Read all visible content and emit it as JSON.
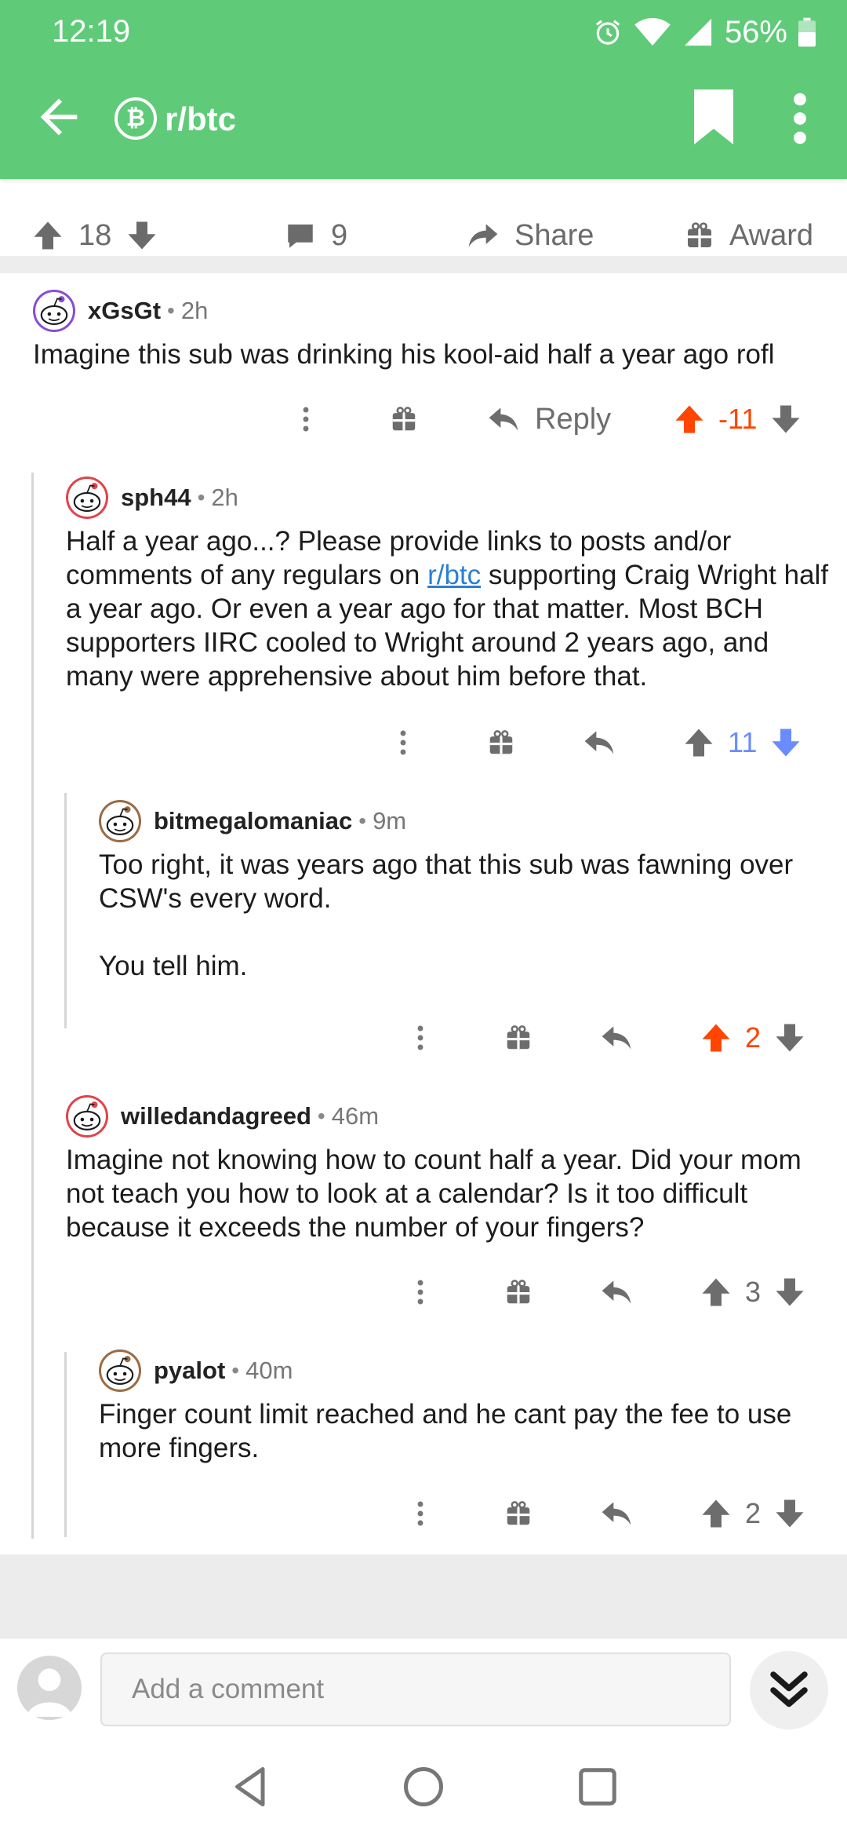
{
  "status": {
    "time": "12:19",
    "battery": "56%",
    "icons": [
      "alarm-icon",
      "wifi-icon",
      "signal-icon",
      "battery-icon"
    ]
  },
  "header": {
    "subreddit": "r/btc",
    "badge": "₿"
  },
  "post_bar": {
    "upvotes": "18",
    "comments": "9",
    "share": "Share",
    "award": "Award"
  },
  "colors": {
    "header": "#5fcb78",
    "upvoted": "#ff4500",
    "downvoted": "#6a8cff",
    "link": "#2a7fd4"
  },
  "comments": [
    {
      "author": "xGsGt",
      "age": "2h",
      "body": "Imagine this sub was drinking his kool-aid half a year ago rofl",
      "reply_label": "Reply",
      "score": "-11",
      "vote": "up"
    },
    {
      "author": "sph44",
      "age": "2h",
      "body_before": "Half a year ago...?  Please provide links to posts and/or comments of any regulars on ",
      "body_link": "r/btc",
      "body_after": " supporting Craig Wright half a year ago.  Or even a year ago for that matter.  Most BCH supporters IIRC cooled to Wright around 2 years ago, and many were apprehensive about him before that.",
      "score": "11",
      "vote": "down"
    },
    {
      "author": "bitmegalomaniac",
      "age": "9m",
      "body_p1": "Too right, it was years ago that this sub was fawning over CSW's every word.",
      "body_p2": "You tell him.",
      "score": "2",
      "vote": "up"
    },
    {
      "author": "willedandagreed",
      "age": "46m",
      "body": "Imagine not knowing how to count half a year. Did your mom not teach you how to look at a calendar? Is it too difficult because it exceeds the number of your fingers?",
      "score": "3",
      "vote": "none"
    },
    {
      "author": "pyalot",
      "age": "40m",
      "body": "Finger count limit reached and he cant pay the fee to use more fingers.",
      "score": "2",
      "vote": "none"
    }
  ],
  "composer": {
    "placeholder": "Add a comment"
  }
}
